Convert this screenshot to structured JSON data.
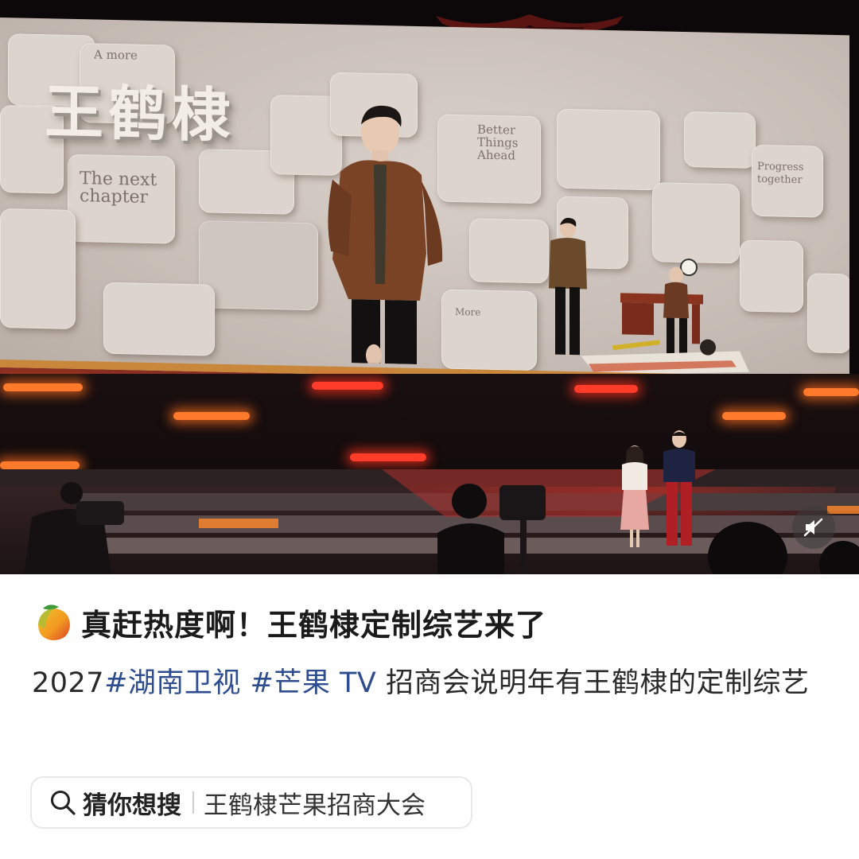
{
  "media": {
    "screen_title": "王鹤棣",
    "puzzle_texts": [
      "A more",
      "The next chapter",
      "Better Things Ahead",
      "Progress together",
      "More"
    ],
    "mute_icon": "speaker-muted-icon"
  },
  "post": {
    "title_icon": "mango-emoji-icon",
    "title": "真赶热度啊！王鹤棣定制综艺来了",
    "body_prefix": "2027",
    "hashtag_1": "#湖南卫视",
    "hashtag_2": "#芒果 TV",
    "body_rest": "招商会说明年有王鹤棣的定制综艺"
  },
  "search": {
    "hint": "猜你想搜",
    "query": "王鹤棣芒果招商大会"
  },
  "colors": {
    "hashtag": "#2d4d8f",
    "stage_red": "#8a2e22",
    "light_orange": "#ff7a2a"
  }
}
